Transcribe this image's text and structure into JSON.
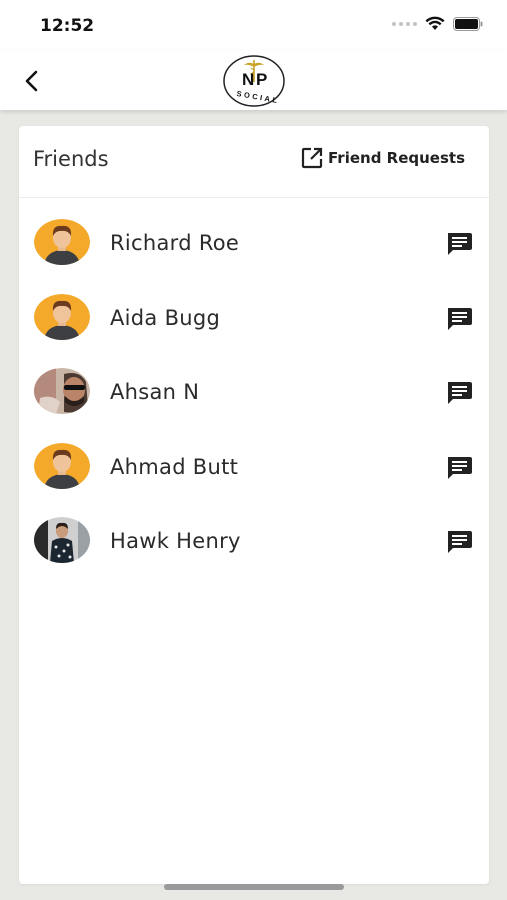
{
  "status_bar": {
    "time": "12:52"
  },
  "header": {
    "logo_letters": "NP",
    "logo_subtext": "SOCIAL"
  },
  "card": {
    "title": "Friends",
    "friend_requests_label": "Friend Requests"
  },
  "friends": [
    {
      "name": "Richard Roe",
      "avatar": "default-avatar-icon"
    },
    {
      "name": "Aida Bugg",
      "avatar": "default-avatar-icon"
    },
    {
      "name": "Ahsan N",
      "avatar": "photo-avatar"
    },
    {
      "name": "Ahmad Butt",
      "avatar": "default-avatar-icon"
    },
    {
      "name": "Hawk Henry",
      "avatar": "photo-avatar"
    }
  ],
  "colors": {
    "avatar_bg": "#f4a92b",
    "background": "#e8e8e5",
    "card": "#ffffff"
  }
}
